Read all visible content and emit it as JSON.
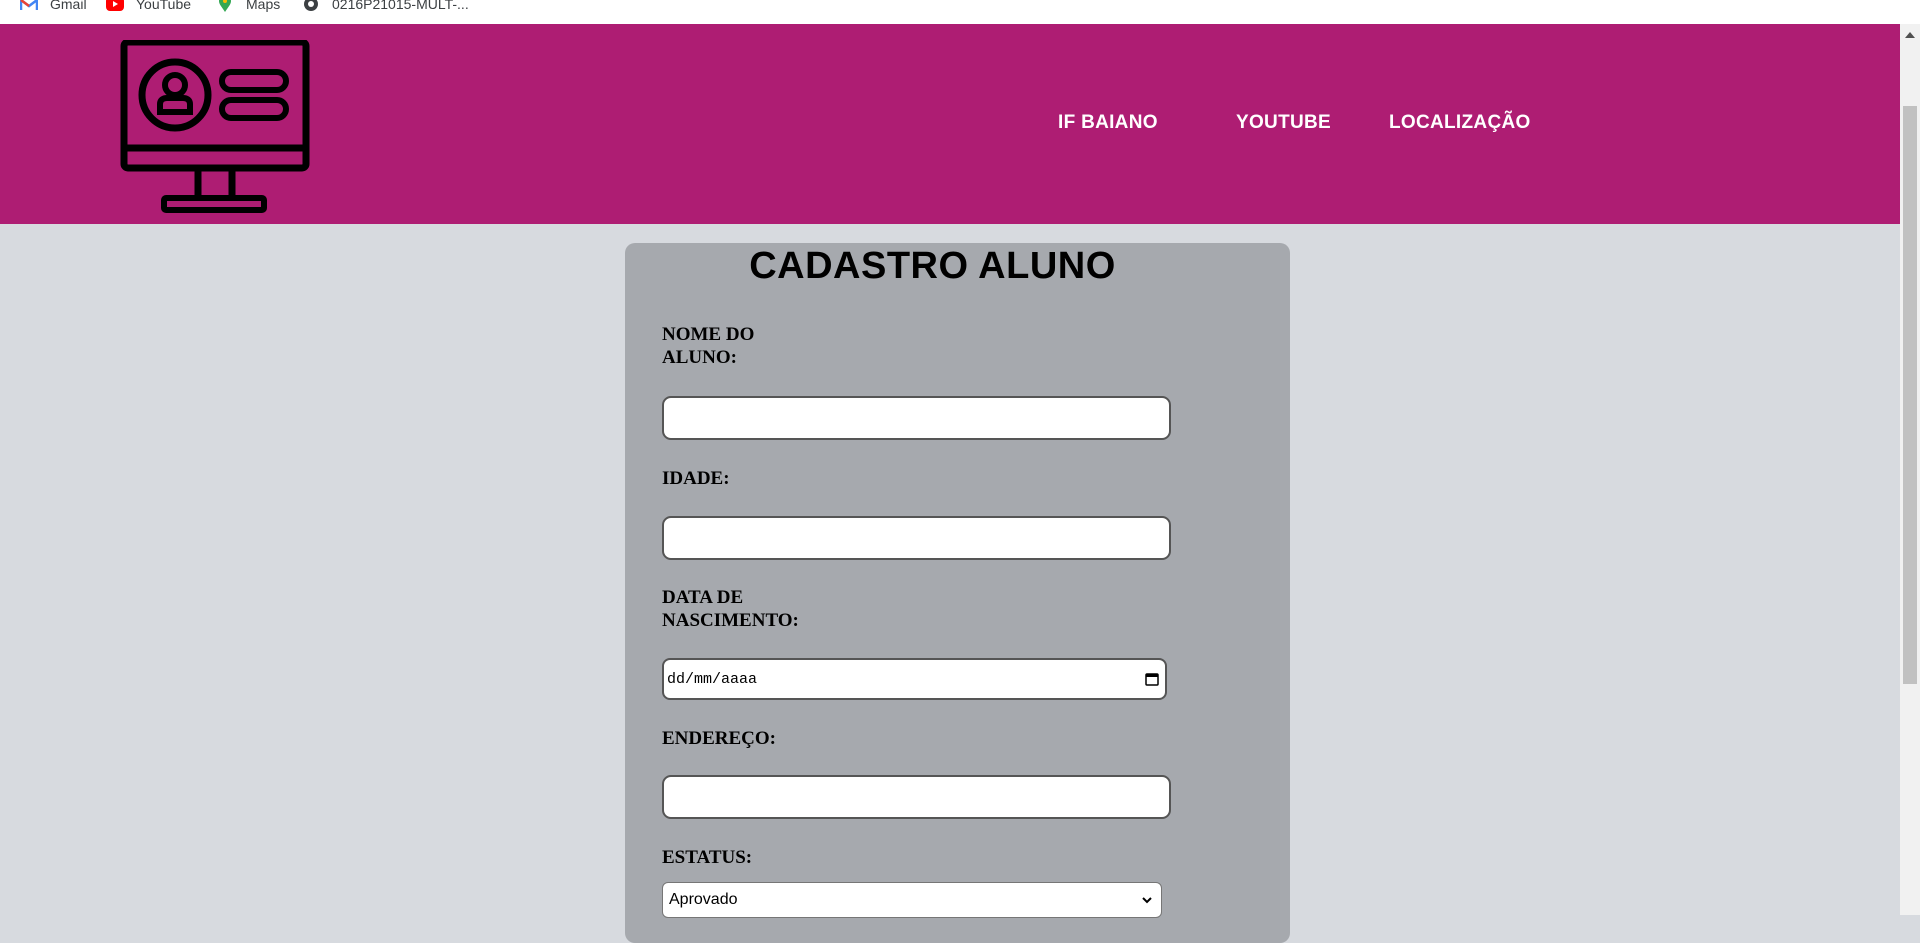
{
  "bookmarks": [
    {
      "label": "Gmail",
      "icon": "gmail-icon"
    },
    {
      "label": "YouTube",
      "icon": "youtube-icon"
    },
    {
      "label": "Maps",
      "icon": "maps-icon"
    },
    {
      "label": "0216P21015-MULT-...",
      "icon": "globe-icon"
    }
  ],
  "header": {
    "logo_icon": "computer-profile-icon",
    "nav": [
      "IF BAIANO",
      "YOUTUBE",
      "LOCALIZAÇÃO"
    ],
    "background_color": "#ae1d73"
  },
  "form": {
    "title": "CADASTRO ALUNO",
    "fields": {
      "nome_label": "NOME DO ALUNO:",
      "nome_value": "",
      "idade_label": "IDADE:",
      "idade_value": "",
      "nascimento_label": "DATA DE NASCIMENTO:",
      "nascimento_placeholder": "dd/mm/aaaa",
      "endereco_label": "ENDEREÇO:",
      "endereco_value": "",
      "estatus_label": "ESTATUS:",
      "estatus_selected": "Aprovado"
    }
  }
}
